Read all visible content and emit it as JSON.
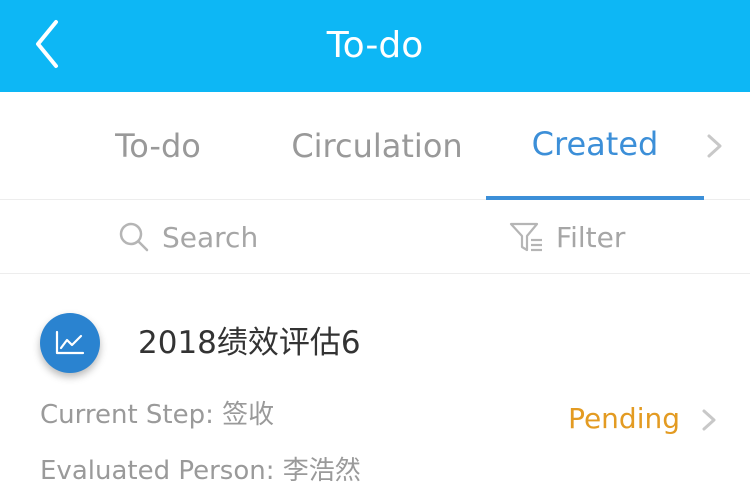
{
  "header": {
    "title": "To-do",
    "back_icon": "chevron-left-icon",
    "background": "#0db7f5"
  },
  "tabs": {
    "items": [
      {
        "label": "To-do"
      },
      {
        "label": "Circulation"
      },
      {
        "label": "Created"
      }
    ],
    "active": "Created",
    "active_color": "#3c8fd8",
    "next_icon": "chevron-right-icon"
  },
  "toolbar": {
    "search_label": "Search",
    "search_icon": "search-icon",
    "filter_label": "Filter",
    "filter_icon": "filter-icon"
  },
  "card": {
    "icon": "chart-icon",
    "title": "2018绩效评估6",
    "current_step_label": "Current Step: ",
    "current_step_value": "签收",
    "evaluated_person_label": "Evaluated Person: ",
    "evaluated_person_value": "李浩然",
    "status": "Pending",
    "status_color": "#e39b22",
    "arrow_icon": "chevron-right-icon"
  }
}
